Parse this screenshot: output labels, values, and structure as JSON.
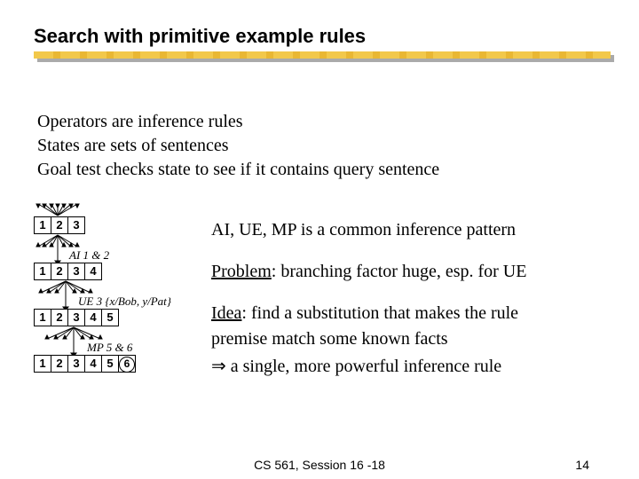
{
  "title": "Search with primitive example rules",
  "bullets": {
    "b1": "Operators are inference rules",
    "b2": "States are sets of sentences",
    "b3": "Goal test checks state to see if it contains query sentence"
  },
  "tree": {
    "r1": {
      "c1": "1",
      "c2": "2",
      "c3": "3"
    },
    "step1": "AI 1 & 2",
    "r2": {
      "c1": "1",
      "c2": "2",
      "c3": "3",
      "c4": "4"
    },
    "step2": "UE 3 {x/Bob, y/Pat}",
    "r3": {
      "c1": "1",
      "c2": "2",
      "c3": "3",
      "c4": "4",
      "c5": "5"
    },
    "step3": "MP 5 & 6",
    "r4": {
      "c1": "1",
      "c2": "2",
      "c3": "3",
      "c4": "4",
      "c5": "5",
      "c6": "6"
    }
  },
  "right": {
    "l1": "AI, UE, MP is a common inference pattern",
    "problem_label": "Problem",
    "problem_text": ": branching factor huge, esp. for UE",
    "idea_label": "Idea",
    "idea_text": ":  find a substitution that makes the rule",
    "idea_cont": "premise match some known facts",
    "arrow": "⇒ a single, more powerful inference rule"
  },
  "footer": {
    "center": "CS 561,  Session 16 -18",
    "page": "14"
  }
}
